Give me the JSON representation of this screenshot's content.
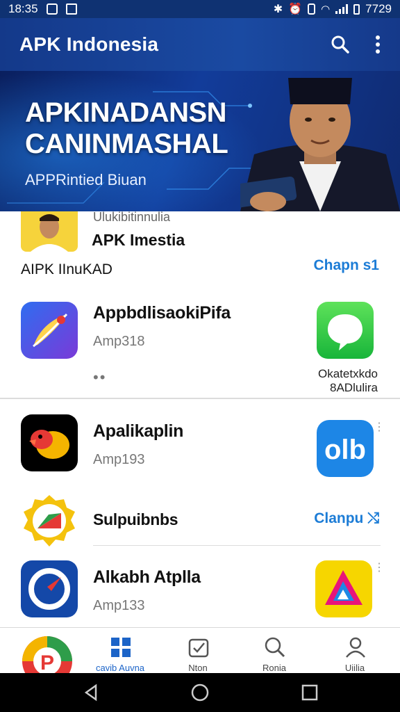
{
  "status_bar": {
    "time_left": "18:35",
    "time_right": "7729"
  },
  "app_bar": {
    "title": "APK Indonesia",
    "search_icon": "search-icon",
    "menu_icon": "overflow-menu-icon"
  },
  "banner": {
    "title_line1": "APKINADANSN",
    "title_line2": "CANINMASHAL",
    "subtitle": "APPRintied Biuan"
  },
  "featured": {
    "small_text": "Ulukibitinnulia",
    "title": "APK Imestia"
  },
  "section": {
    "title": "AIPK IInuKAD",
    "link": "Chapn  s1"
  },
  "apps_top": {
    "name": "AppbdlisaokiPifa",
    "meta": "Amp318",
    "more": "••",
    "side_label_line1": "Okatetxkdo",
    "side_label_line2": "8ADlulira"
  },
  "apps": [
    {
      "name": "Apalikaplin",
      "meta": "Amp193"
    },
    {
      "name": "Sulpuibnbs",
      "install": "Clanpu  ⤭"
    },
    {
      "name": "Alkabh Atplla",
      "meta": "Amp133"
    }
  ],
  "bottom_nav": [
    {
      "label": "",
      "icon": "app-logo-icon"
    },
    {
      "label": "cavib Auvna",
      "icon": "grid-icon"
    },
    {
      "label": "Nton",
      "icon": "check-badge-icon"
    },
    {
      "label": "Ronia",
      "icon": "search-icon"
    },
    {
      "label": "Uiilia",
      "icon": "person-icon"
    }
  ],
  "colors": {
    "primary": "#14398a",
    "accent": "#1c7cd6"
  }
}
